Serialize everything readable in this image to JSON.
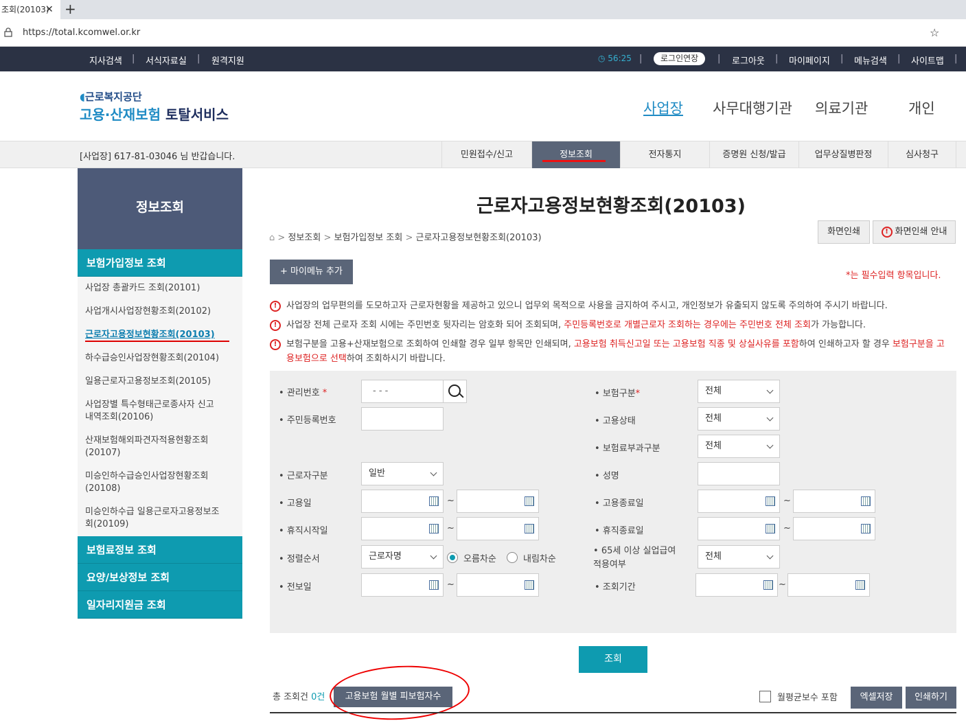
{
  "browser": {
    "tab_title": "조회(20103)",
    "close_glyph": "✕",
    "new_tab_glyph": "+",
    "url": "https://total.kcomwel.or.kr"
  },
  "topnav": {
    "left": [
      "지사검색",
      "서식자료실",
      "원격지원"
    ],
    "timer": "56:25",
    "extend_login": "로그인연장",
    "right": [
      "로그아웃",
      "마이페이지",
      "메뉴검색",
      "사이트맵"
    ],
    "separator": "|"
  },
  "header": {
    "logo_top": "근로복지공단",
    "logo_main_a": "고용·산재보험",
    "logo_main_b": "토탈서비스",
    "gnb": [
      "사업장",
      "사무대행기관",
      "의료기관",
      "개인"
    ]
  },
  "subnav": {
    "greeting": "[사업장] 617-81-03046 님 반갑습니다.",
    "items": [
      "민원접수/신고",
      "정보조회",
      "전자통지",
      "증명원 신청/발급",
      "업무상질병판정",
      "심사청구"
    ]
  },
  "sidebar": {
    "title": "정보조회",
    "cat1": "보험가입정보 조회",
    "items": [
      "사업장 총괄카드 조회(20101)",
      "사업개시사업장현황조회(20102)",
      "근로자고용정보현황조회(20103)",
      "하수급승인사업장현황조회(20104)",
      "일용근로자고용정보조회(20105)",
      "사업장별 특수형태근로종사자 신고내역조회(20106)",
      "산재보험해외파견자적용현황조회 (20107)",
      "미승인하수급승인사업장현황조회 (20108)",
      "미승인하수급 일용근로자고용정보조회(20109)"
    ],
    "cats": [
      "보험료정보 조회",
      "요양/보상정보 조회",
      "일자리지원금 조회"
    ]
  },
  "main": {
    "title": "근로자고용정보현황조회(20103)",
    "breadcrumb": [
      "정보조회",
      "보험가입정보 조회",
      "근로자고용정보현황조회(20103)"
    ],
    "breadcrumb_sep": ">",
    "print_btn": "화면인쇄",
    "print_guide_btn": "화면인쇄 안내",
    "mymenu_btn": "+ 마이메뉴 추가",
    "required_star": "*",
    "required_text": "는 필수입력 항목입니다.",
    "notice_icon": "!"
  },
  "notices": {
    "n1": "사업장의 업무편의를 도모하고자 근로자현황을 제공하고 있으니 업무외 목적으로 사용을 금지하여 주시고, 개인정보가 유출되지 않도록 주의하여 주시기 바랍니다.",
    "n2a": "사업장 전체 근로자 조회 시에는 주민번호 뒷자리는 암호화 되어 조회되며, ",
    "n2b": "주민등록번호로 개별근로자 조회하는 경우에는 주민번호 전체 조회",
    "n2c": "가 가능합니다.",
    "n3a": "보험구분을 고용+산재보험으로 조회하여 인쇄할 경우 일부 항목만 인쇄되며, ",
    "n3b": "고용보험 취득신고일 또는 고용보험 직종 및 상실사유를 포함",
    "n3c": "하여 인쇄하고자 할 경우 ",
    "n3d": "보험구분을 고용보험으로 선택",
    "n3e": "하여 조회하시기 바랍니다."
  },
  "form": {
    "bullet": "•",
    "mgmt_no_label": "관리번호",
    "mgmt_no_placeholder": "- - -",
    "rrn_label": "주민등록번호",
    "worker_type_label": "근로자구분",
    "worker_type_value": "일반",
    "hire_date_label": "고용일",
    "leave_start_label": "휴직시작일",
    "sort_label": "정렬순서",
    "sort_value": "근로자명",
    "asc": "오름차순",
    "desc": "내림차순",
    "transfer_label": "전보일",
    "ins_type_label": "보험구분",
    "ins_type_value": "전체",
    "emp_status_label": "고용상태",
    "emp_status_value": "전체",
    "premium_type_label": "보험료부과구분",
    "premium_type_value": "전체",
    "name_label": "성명",
    "end_date_label": "고용종료일",
    "leave_end_label": "휴직종료일",
    "over65_label_1": "65세 이상 실업급여",
    "over65_label_2": "적용여부",
    "over65_value": "전체",
    "period_label": "조회기간",
    "req_star": "*",
    "tilde": "~"
  },
  "results": {
    "query_btn": "조회",
    "total_label": "총 조회건 ",
    "total_count": "0건",
    "monthly_btn": "고용보험 월별 피보험자수",
    "avg_label": "월평균보수 포함",
    "excel_btn": "엑셀저장",
    "print_btn": "인쇄하기"
  }
}
